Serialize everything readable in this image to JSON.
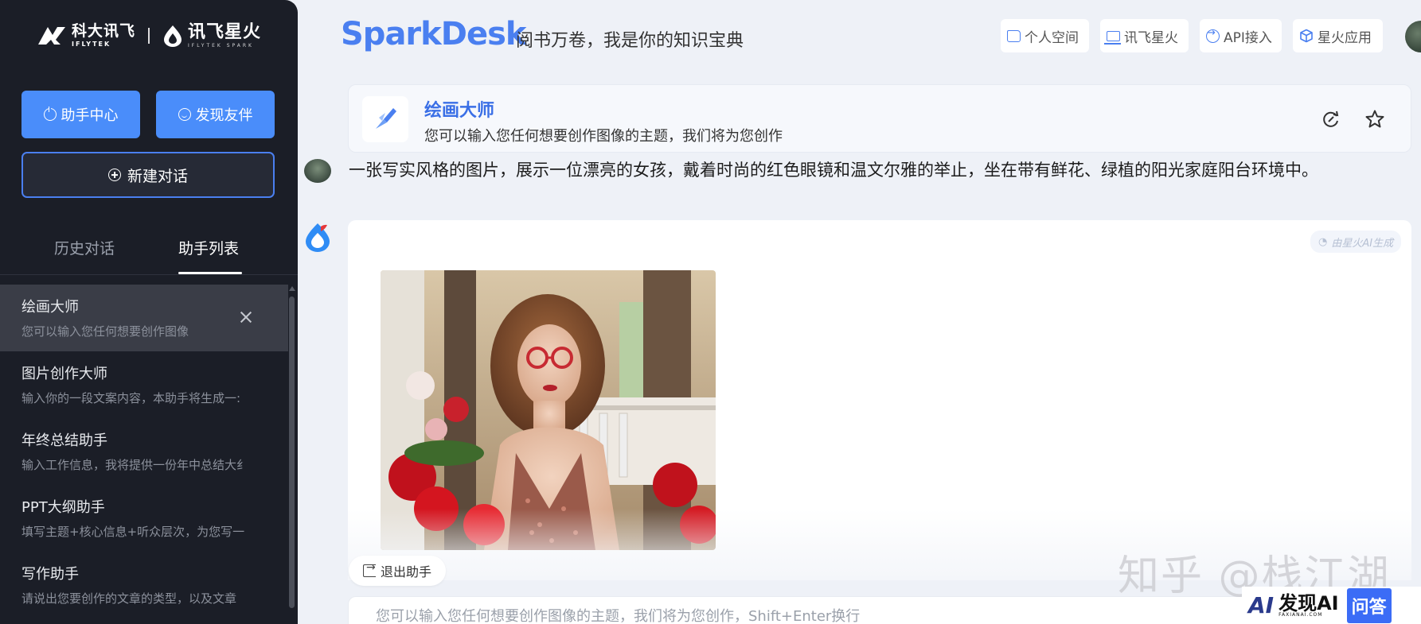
{
  "logo": {
    "iflytek_cn": "科大讯飞",
    "iflytek_en": "IFLYTEK",
    "spark_cn": "讯飞星火",
    "spark_en": "IFLYTEK SPARK"
  },
  "sidebar": {
    "assistant_center_label": "助手中心",
    "discover_partner_label": "发现友伴",
    "new_chat_label": "新建对话",
    "tabs": [
      {
        "label": "历史对话",
        "active": false
      },
      {
        "label": "助手列表",
        "active": true
      }
    ],
    "items": [
      {
        "title": "绘画大师",
        "desc": "您可以输入您任何想要创作图像",
        "active": true
      },
      {
        "title": "图片创作大师",
        "desc": "输入你的一段文案内容，本助手将生成一:",
        "active": false
      },
      {
        "title": "年终总结助手",
        "desc": "输入工作信息，我将提供一份年中总结大纟",
        "active": false
      },
      {
        "title": "PPT大纲助手",
        "desc": "填写主题+核心信息+听众层次，为您写一",
        "active": false
      },
      {
        "title": "写作助手",
        "desc": "请说出您要创作的文章的类型，以及文章",
        "active": false
      }
    ]
  },
  "header": {
    "brand": "SparkDesk",
    "slogan": "阅书万卷，我是你的知识宝典",
    "nav": [
      {
        "label": "个人空间",
        "icon": "folder-icon"
      },
      {
        "label": "讯飞星火",
        "icon": "laptop-icon"
      },
      {
        "label": "API接入",
        "icon": "api-icon"
      },
      {
        "label": "星火应用",
        "icon": "cube-icon"
      }
    ]
  },
  "assistant": {
    "name": "绘画大师",
    "desc": "您可以输入您任何想要创作图像的主题，我们将为您创作"
  },
  "chat": {
    "user_message": "一张写实风格的图片，展示一位漂亮的女孩，戴着时尚的红色眼镜和温文尔雅的举止，坐在带有鲜花、绿植的阳光家庭阳台环境中。",
    "ai_tag": "由星火AI生成",
    "exit_label": "退出助手",
    "input_placeholder": "您可以输入您任何想要创作图像的主题，我们将为您创作，Shift+Enter换行"
  },
  "watermarks": {
    "zhihu": "知乎 @栈江湖",
    "faxian_ai": "AI",
    "faxian_text": "发现AI",
    "faxian_domain": "FAXIANAI.COM",
    "faxian_qa": "问答"
  },
  "colors": {
    "accent": "#4a8dfa",
    "brand_blue": "#4a7ff0",
    "sidebar_bg": "#1b1e27",
    "page_bg": "#eef1f7"
  }
}
